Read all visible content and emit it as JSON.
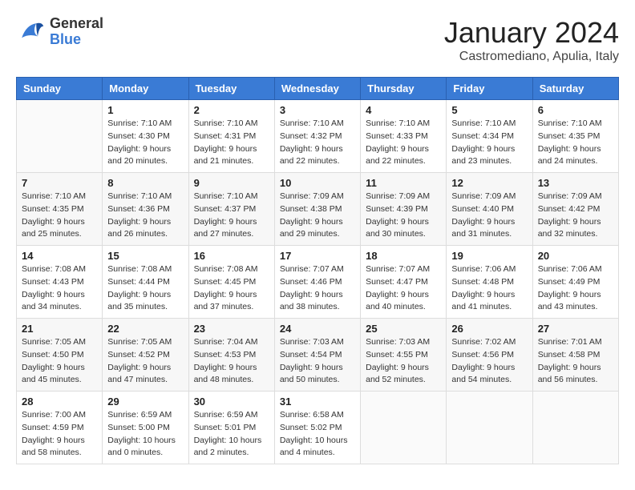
{
  "logo": {
    "line1": "General",
    "line2": "Blue"
  },
  "title": "January 2024",
  "location": "Castromediano, Apulia, Italy",
  "days_of_week": [
    "Sunday",
    "Monday",
    "Tuesday",
    "Wednesday",
    "Thursday",
    "Friday",
    "Saturday"
  ],
  "weeks": [
    [
      {
        "num": "",
        "sunrise": "",
        "sunset": "",
        "daylight": "",
        "empty": true
      },
      {
        "num": "1",
        "sunrise": "Sunrise: 7:10 AM",
        "sunset": "Sunset: 4:30 PM",
        "daylight": "Daylight: 9 hours and 20 minutes."
      },
      {
        "num": "2",
        "sunrise": "Sunrise: 7:10 AM",
        "sunset": "Sunset: 4:31 PM",
        "daylight": "Daylight: 9 hours and 21 minutes."
      },
      {
        "num": "3",
        "sunrise": "Sunrise: 7:10 AM",
        "sunset": "Sunset: 4:32 PM",
        "daylight": "Daylight: 9 hours and 22 minutes."
      },
      {
        "num": "4",
        "sunrise": "Sunrise: 7:10 AM",
        "sunset": "Sunset: 4:33 PM",
        "daylight": "Daylight: 9 hours and 22 minutes."
      },
      {
        "num": "5",
        "sunrise": "Sunrise: 7:10 AM",
        "sunset": "Sunset: 4:34 PM",
        "daylight": "Daylight: 9 hours and 23 minutes."
      },
      {
        "num": "6",
        "sunrise": "Sunrise: 7:10 AM",
        "sunset": "Sunset: 4:35 PM",
        "daylight": "Daylight: 9 hours and 24 minutes."
      }
    ],
    [
      {
        "num": "7",
        "sunrise": "Sunrise: 7:10 AM",
        "sunset": "Sunset: 4:35 PM",
        "daylight": "Daylight: 9 hours and 25 minutes."
      },
      {
        "num": "8",
        "sunrise": "Sunrise: 7:10 AM",
        "sunset": "Sunset: 4:36 PM",
        "daylight": "Daylight: 9 hours and 26 minutes."
      },
      {
        "num": "9",
        "sunrise": "Sunrise: 7:10 AM",
        "sunset": "Sunset: 4:37 PM",
        "daylight": "Daylight: 9 hours and 27 minutes."
      },
      {
        "num": "10",
        "sunrise": "Sunrise: 7:09 AM",
        "sunset": "Sunset: 4:38 PM",
        "daylight": "Daylight: 9 hours and 29 minutes."
      },
      {
        "num": "11",
        "sunrise": "Sunrise: 7:09 AM",
        "sunset": "Sunset: 4:39 PM",
        "daylight": "Daylight: 9 hours and 30 minutes."
      },
      {
        "num": "12",
        "sunrise": "Sunrise: 7:09 AM",
        "sunset": "Sunset: 4:40 PM",
        "daylight": "Daylight: 9 hours and 31 minutes."
      },
      {
        "num": "13",
        "sunrise": "Sunrise: 7:09 AM",
        "sunset": "Sunset: 4:42 PM",
        "daylight": "Daylight: 9 hours and 32 minutes."
      }
    ],
    [
      {
        "num": "14",
        "sunrise": "Sunrise: 7:08 AM",
        "sunset": "Sunset: 4:43 PM",
        "daylight": "Daylight: 9 hours and 34 minutes."
      },
      {
        "num": "15",
        "sunrise": "Sunrise: 7:08 AM",
        "sunset": "Sunset: 4:44 PM",
        "daylight": "Daylight: 9 hours and 35 minutes."
      },
      {
        "num": "16",
        "sunrise": "Sunrise: 7:08 AM",
        "sunset": "Sunset: 4:45 PM",
        "daylight": "Daylight: 9 hours and 37 minutes."
      },
      {
        "num": "17",
        "sunrise": "Sunrise: 7:07 AM",
        "sunset": "Sunset: 4:46 PM",
        "daylight": "Daylight: 9 hours and 38 minutes."
      },
      {
        "num": "18",
        "sunrise": "Sunrise: 7:07 AM",
        "sunset": "Sunset: 4:47 PM",
        "daylight": "Daylight: 9 hours and 40 minutes."
      },
      {
        "num": "19",
        "sunrise": "Sunrise: 7:06 AM",
        "sunset": "Sunset: 4:48 PM",
        "daylight": "Daylight: 9 hours and 41 minutes."
      },
      {
        "num": "20",
        "sunrise": "Sunrise: 7:06 AM",
        "sunset": "Sunset: 4:49 PM",
        "daylight": "Daylight: 9 hours and 43 minutes."
      }
    ],
    [
      {
        "num": "21",
        "sunrise": "Sunrise: 7:05 AM",
        "sunset": "Sunset: 4:50 PM",
        "daylight": "Daylight: 9 hours and 45 minutes."
      },
      {
        "num": "22",
        "sunrise": "Sunrise: 7:05 AM",
        "sunset": "Sunset: 4:52 PM",
        "daylight": "Daylight: 9 hours and 47 minutes."
      },
      {
        "num": "23",
        "sunrise": "Sunrise: 7:04 AM",
        "sunset": "Sunset: 4:53 PM",
        "daylight": "Daylight: 9 hours and 48 minutes."
      },
      {
        "num": "24",
        "sunrise": "Sunrise: 7:03 AM",
        "sunset": "Sunset: 4:54 PM",
        "daylight": "Daylight: 9 hours and 50 minutes."
      },
      {
        "num": "25",
        "sunrise": "Sunrise: 7:03 AM",
        "sunset": "Sunset: 4:55 PM",
        "daylight": "Daylight: 9 hours and 52 minutes."
      },
      {
        "num": "26",
        "sunrise": "Sunrise: 7:02 AM",
        "sunset": "Sunset: 4:56 PM",
        "daylight": "Daylight: 9 hours and 54 minutes."
      },
      {
        "num": "27",
        "sunrise": "Sunrise: 7:01 AM",
        "sunset": "Sunset: 4:58 PM",
        "daylight": "Daylight: 9 hours and 56 minutes."
      }
    ],
    [
      {
        "num": "28",
        "sunrise": "Sunrise: 7:00 AM",
        "sunset": "Sunset: 4:59 PM",
        "daylight": "Daylight: 9 hours and 58 minutes."
      },
      {
        "num": "29",
        "sunrise": "Sunrise: 6:59 AM",
        "sunset": "Sunset: 5:00 PM",
        "daylight": "Daylight: 10 hours and 0 minutes."
      },
      {
        "num": "30",
        "sunrise": "Sunrise: 6:59 AM",
        "sunset": "Sunset: 5:01 PM",
        "daylight": "Daylight: 10 hours and 2 minutes."
      },
      {
        "num": "31",
        "sunrise": "Sunrise: 6:58 AM",
        "sunset": "Sunset: 5:02 PM",
        "daylight": "Daylight: 10 hours and 4 minutes."
      },
      {
        "num": "",
        "sunrise": "",
        "sunset": "",
        "daylight": "",
        "empty": true
      },
      {
        "num": "",
        "sunrise": "",
        "sunset": "",
        "daylight": "",
        "empty": true
      },
      {
        "num": "",
        "sunrise": "",
        "sunset": "",
        "daylight": "",
        "empty": true
      }
    ]
  ]
}
